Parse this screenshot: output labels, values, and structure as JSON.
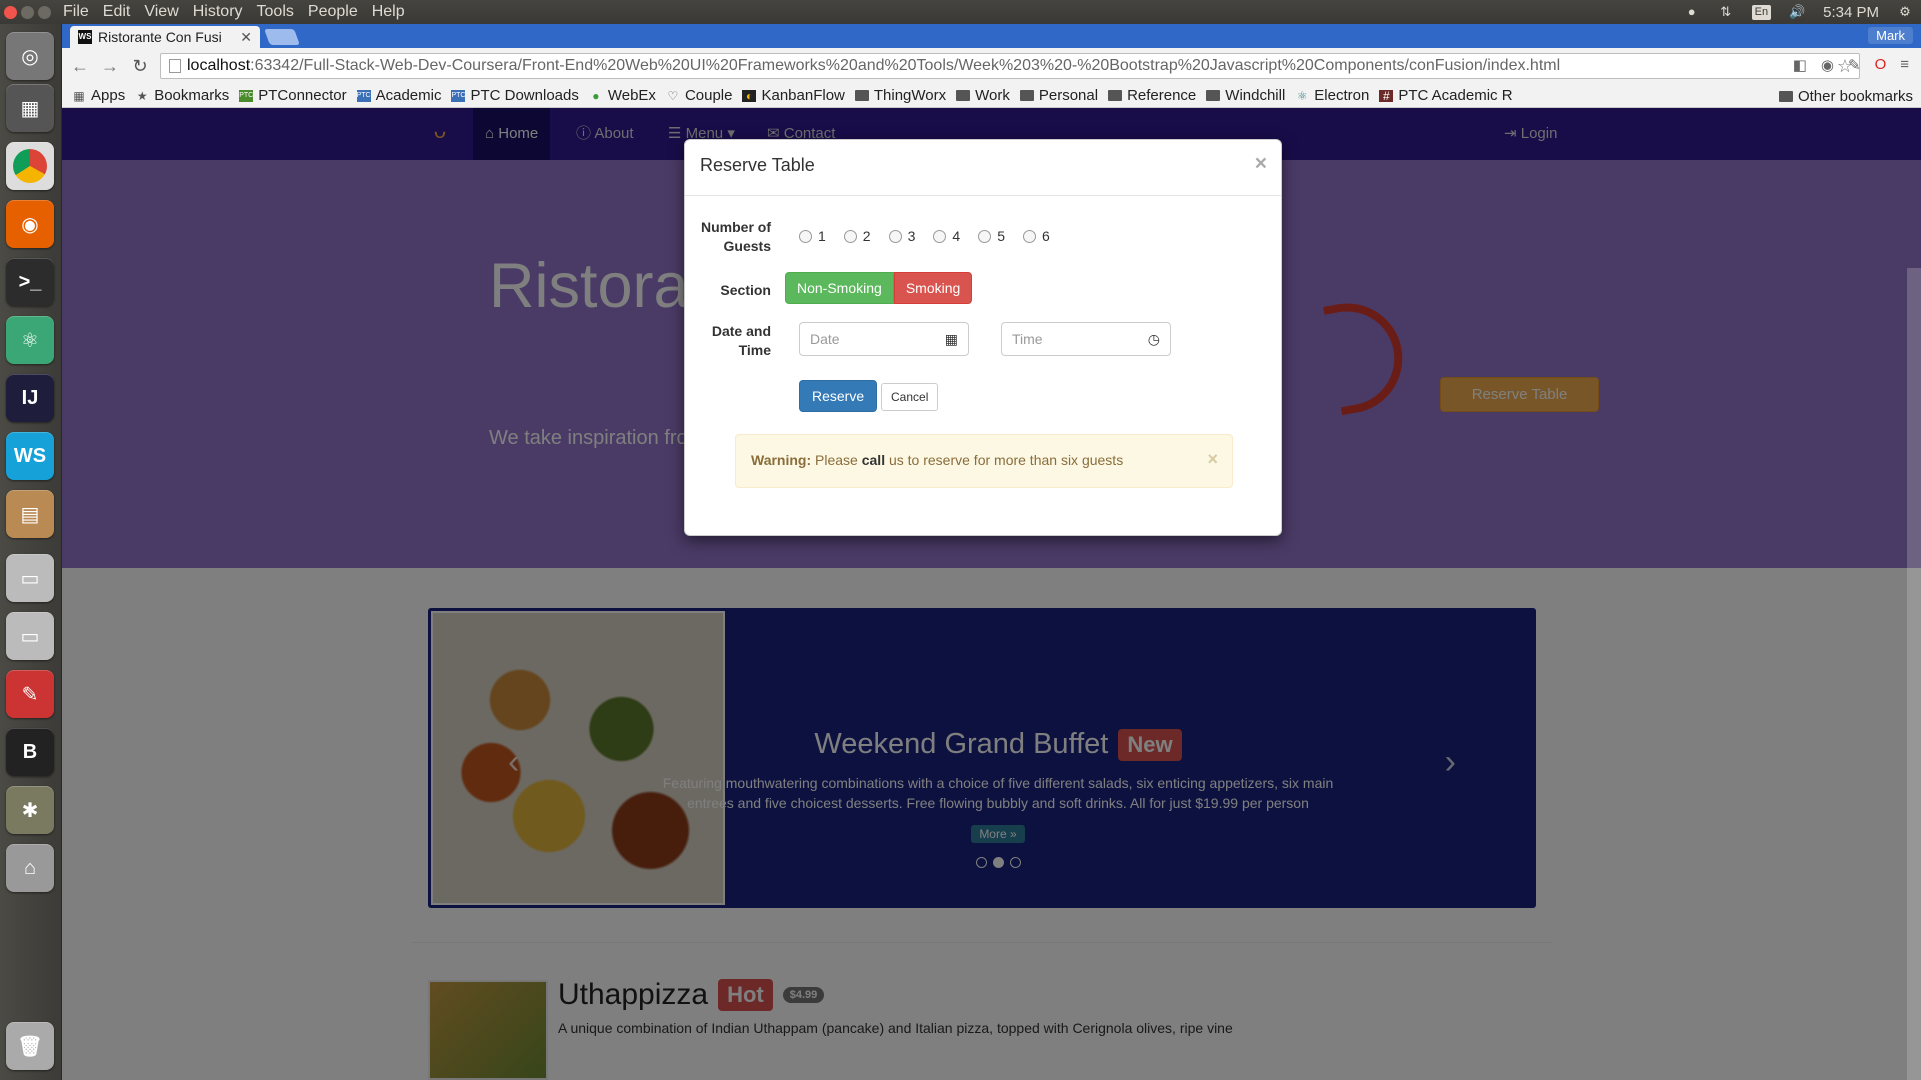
{
  "os": {
    "menu": [
      "File",
      "Edit",
      "View",
      "History",
      "Tools",
      "People",
      "Help"
    ],
    "lang": "En",
    "clock": "5:34 PM"
  },
  "browser": {
    "tab_title": "Ristorante Con Fusi",
    "profile": "Mark",
    "url_host": "localhost",
    "url_rest": ":63342/Full-Stack-Web-Dev-Coursera/Front-End%20Web%20UI%20Frameworks%20and%20Tools/Week%203%20-%20Bootstrap%20Javascript%20Components/conFusion/index.html",
    "bookmarks": [
      "Apps",
      "Bookmarks",
      "PTConnector",
      "Academic",
      "PTC Downloads",
      "WebEx",
      "Couple",
      "KanbanFlow",
      "ThingWorx",
      "Work",
      "Personal",
      "Reference",
      "Windchill",
      "Electron",
      "PTC Academic R"
    ],
    "other_bookmarks": "Other bookmarks"
  },
  "site": {
    "nav": [
      "Home",
      "About",
      "Menu",
      "Contact"
    ],
    "login": "Login",
    "jumbo_title": "Ristorant",
    "jumbo_text": "We take inspiration from the experience. Our lipsmackin",
    "reserve_button": "Reserve Table",
    "carousel": {
      "title": "Weekend Grand Buffet",
      "label": "New",
      "text": "Featuring mouthwatering combinations with a choice of five different salads, six enticing appetizers, six main entrees and five choicest desserts. Free flowing bubbly and soft drinks. All for just $19.99 per person",
      "more": "More »"
    },
    "dish": {
      "name": "Uthappizza",
      "label": "Hot",
      "price": "$4.99",
      "desc": "A unique combination of Indian Uthappam (pancake) and Italian pizza, topped with Cerignola olives, ripe vine"
    }
  },
  "modal": {
    "title": "Reserve Table",
    "close": "×",
    "guests_label": "Number of Guests",
    "guests": [
      "1",
      "2",
      "3",
      "4",
      "5",
      "6"
    ],
    "section_label": "Section",
    "non_smoking": "Non-Smoking",
    "smoking": "Smoking",
    "datetime_label": "Date and Time",
    "date_placeholder": "Date",
    "time_placeholder": "Time",
    "reserve": "Reserve",
    "cancel": "Cancel",
    "alert_strong": "Warning:",
    "alert_pre": "Please",
    "alert_call": "call",
    "alert_post": "us to reserve for more than six guests",
    "alert_close": "×"
  }
}
